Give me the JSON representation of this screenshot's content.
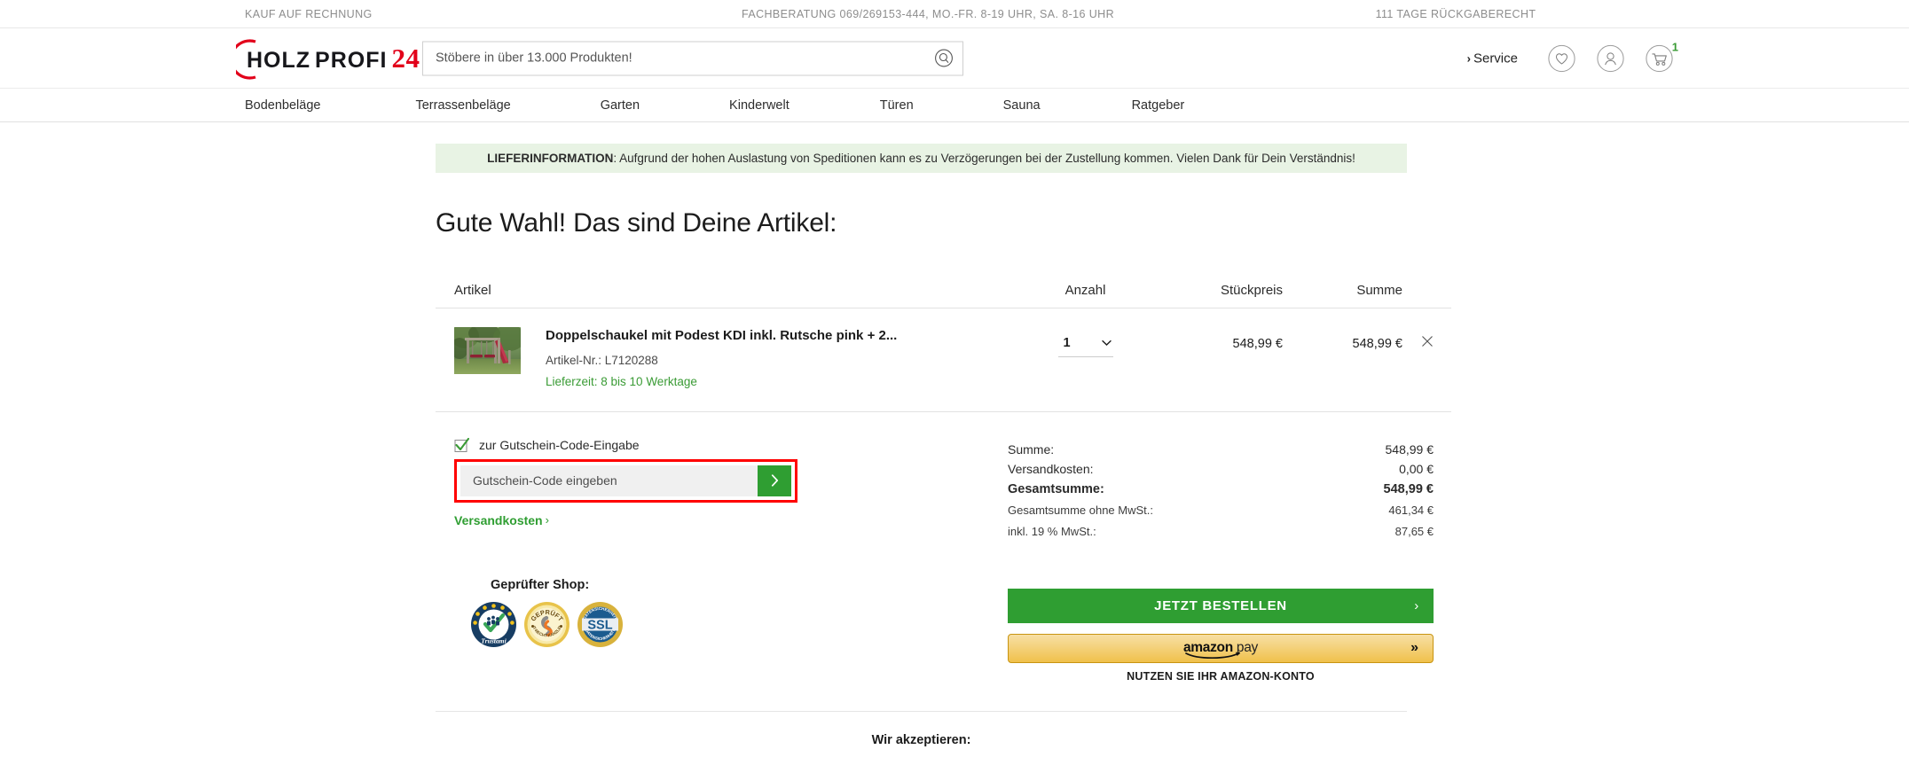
{
  "topbar": {
    "items": [
      "KAUF AUF RECHNUNG",
      "FACHBERATUNG 069/269153-444, MO.-FR. 8-19 UHR, SA. 8-16 UHR",
      "111 TAGE RÜCKGABERECHT"
    ]
  },
  "header": {
    "logo": {
      "part1": "HOLZ",
      "part2": "PROFI",
      "part3": "24"
    },
    "search": {
      "placeholder": "Stöbere in über 13.000 Produkten!",
      "value": "",
      "icon": "search-icon"
    },
    "service_label": "Service",
    "icons": {
      "wishlist": "heart-icon",
      "account": "user-icon",
      "cart": "cart-icon"
    },
    "cart_count": "1"
  },
  "nav": {
    "items": [
      "Bodenbeläge",
      "Terrassenbeläge",
      "Garten",
      "Kinderwelt",
      "Türen",
      "Sauna",
      "Ratgeber"
    ]
  },
  "notice": {
    "label": "LIEFERINFORMATION",
    "text": ": Aufgrund der hohen Auslastung von Speditionen kann es zu Verzögerungen bei der Zustellung kommen. Vielen Dank für Dein Verständnis!"
  },
  "page_title": "Gute Wahl! Das sind Deine Artikel:",
  "cart": {
    "headers": {
      "article": "Artikel",
      "qty": "Anzahl",
      "unit_price": "Stückpreis",
      "sum": "Summe"
    },
    "rows": [
      {
        "title": "Doppelschaukel mit Podest KDI inkl. Rutsche pink + 2...",
        "sku": "Artikel-Nr.: L7120288",
        "delivery": "Lieferzeit: 8 bis 10 Werktage",
        "qty": "1",
        "unit_price": "548,99 €",
        "sum": "548,99 €",
        "remove_icon": "close-icon"
      }
    ]
  },
  "voucher": {
    "toggle_label": "zur Gutschein-Code-Eingabe",
    "placeholder": "Gutschein-Code eingeben",
    "value": "",
    "submit_icon": "chevron-right-icon",
    "shipping_link": "Versandkosten",
    "highlight_color": "#ff0000"
  },
  "summary": {
    "lines": [
      {
        "label": "Summe:",
        "value": "548,99 €",
        "style": "normal"
      },
      {
        "label": "Versandkosten:",
        "value": "0,00 €",
        "style": "normal"
      },
      {
        "label": "Gesamtsumme:",
        "value": "548,99 €",
        "style": "total"
      },
      {
        "label": "Gesamtsumme ohne MwSt.:",
        "value": "461,34 €",
        "style": "small"
      },
      {
        "label": "inkl. 19 % MwSt.:",
        "value": "87,65 €",
        "style": "small"
      }
    ]
  },
  "seals": {
    "title": "Geprüfter Shop:",
    "items": [
      "trustami-seal",
      "it-recht-kanzlei-seal",
      "ssl-seal"
    ],
    "seal2_top": "GEPRÜFT",
    "seal2_bottom": "IT-RECHT KANZLEI",
    "seal3_text": "SSL",
    "seal3_ring_top": "DATENSICHERHEIT",
    "seal3_ring_bottom": "DATENSICHERHEIT",
    "seal1_text": "Trustami"
  },
  "checkout": {
    "order_button": "JETZT BESTELLEN",
    "order_chevron": "›",
    "amazon_word": "amazon",
    "amazon_pay": " pay",
    "amazon_chevron": "»",
    "amazon_note": "NUTZEN SIE IHR AMAZON-KONTO"
  },
  "footer": {
    "accept_title": "Wir akzeptieren:"
  },
  "colors": {
    "brand_red": "#e2001a",
    "green": "#2f9e32",
    "notice_bg": "#e8f3e4",
    "amazon_gold": "#f0c14b",
    "highlight": "#ff0000"
  }
}
